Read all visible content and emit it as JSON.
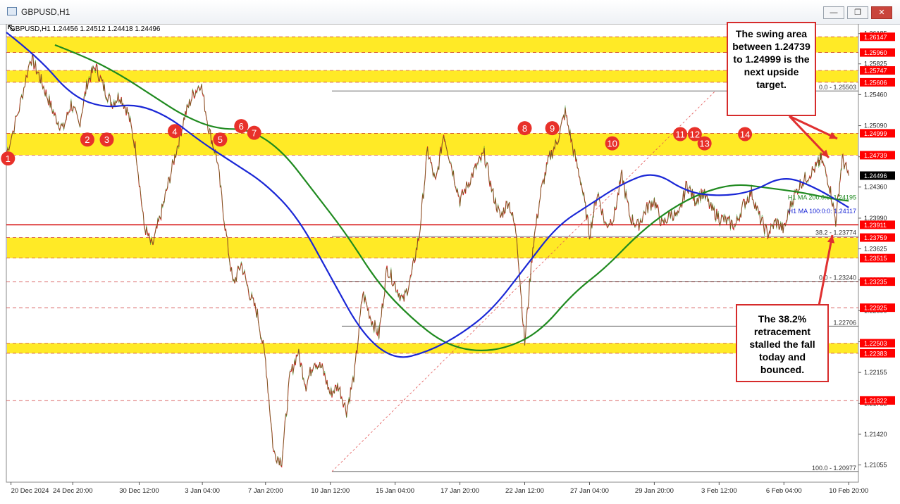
{
  "window": {
    "title": "GBPUSD,H1",
    "buttons": [
      "minimize-icon",
      "restore-icon",
      "close-icon"
    ]
  },
  "ohlc_header": "GBPUSD,H1  1.24456 1.24512 1.24418 1.24496",
  "colors": {
    "zone": "#ffe600",
    "ma100": "#1a27d6",
    "ma200": "#1f8a1f",
    "candle": "#cc2020",
    "callout_border": "#d62b2b",
    "marker": "#e8312a",
    "current_price_bg": "#000000"
  },
  "chart_data": {
    "type": "line",
    "title": "GBPUSD,H1",
    "ylim": [
      1.2085,
      1.263
    ],
    "y_ticks": [
      "1.26185",
      "1.25825",
      "1.25460",
      "1.25090",
      "1.24720",
      "1.24360",
      "1.23990",
      "1.23625",
      "1.23255",
      "1.22890",
      "1.22520",
      "1.22155",
      "1.21785",
      "1.21420",
      "1.21055"
    ],
    "x_ticks": [
      "20 Dec 2024",
      "24 Dec 20:00",
      "30 Dec 12:00",
      "3 Jan 04:00",
      "7 Jan 20:00",
      "10 Jan 12:00",
      "15 Jan 04:00",
      "17 Jan 20:00",
      "22 Jan 12:00",
      "27 Jan 04:00",
      "29 Jan 20:00",
      "3 Feb 12:00",
      "6 Feb 04:00",
      "10 Feb 20:00"
    ],
    "zones": [
      {
        "low": 1.2596,
        "high": 1.26147
      },
      {
        "low": 1.25606,
        "high": 1.25747
      },
      {
        "low": 1.24739,
        "high": 1.24999
      },
      {
        "low": 1.23515,
        "high": 1.23759
      },
      {
        "low": 1.22383,
        "high": 1.22503
      }
    ],
    "price_labels": [
      {
        "value": 1.26147,
        "text": "1.26147",
        "color": "#ff0000"
      },
      {
        "value": 1.2596,
        "text": "1.25960",
        "color": "#ff0000"
      },
      {
        "value": 1.25747,
        "text": "1.25747",
        "color": "#ff0000"
      },
      {
        "value": 1.25606,
        "text": "1.25606",
        "color": "#ff0000"
      },
      {
        "value": 1.24999,
        "text": "1.24999",
        "color": "#ff0000"
      },
      {
        "value": 1.24739,
        "text": "1.24739",
        "color": "#ff0000"
      },
      {
        "value": 1.24496,
        "text": "1.24496",
        "color": "#000000"
      },
      {
        "value": 1.23911,
        "text": "1.23911",
        "color": "#ff0000"
      },
      {
        "value": 1.23759,
        "text": "1.23759",
        "color": "#ff0000"
      },
      {
        "value": 1.23515,
        "text": "1.23515",
        "color": "#ff0000"
      },
      {
        "value": 1.23235,
        "text": "1.23235",
        "color": "#ff0000"
      },
      {
        "value": 1.22925,
        "text": "1.22925",
        "color": "#ff0000"
      },
      {
        "value": 1.22503,
        "text": "1.22503",
        "color": "#ff0000"
      },
      {
        "value": 1.22383,
        "text": "1.22383",
        "color": "#ff0000"
      },
      {
        "value": 1.21822,
        "text": "1.21822",
        "color": "#ff0000"
      }
    ],
    "fib_levels": [
      {
        "value": 1.25503,
        "text": "0.0 - 1.25503"
      },
      {
        "value": 1.23774,
        "text": "38.2 - 1.23774"
      },
      {
        "value": 1.2324,
        "text": "0.0 - 1.23240"
      },
      {
        "value": 1.22706,
        "text": "1.22706"
      },
      {
        "value": 1.20977,
        "text": "100.0 - 1.20977"
      }
    ],
    "ma_labels": [
      {
        "text": "H1 MA 200:0:0: 1.24195",
        "value": 1.24195,
        "color": "#1f8a1f"
      },
      {
        "text": "H1 MA 100:0:0: 1.24117",
        "value": 1.24117,
        "color": "#1a27d6"
      }
    ],
    "series": [
      {
        "name": "Price",
        "x": [
          0,
          0.8,
          1.5,
          2,
          2.5,
          3,
          3.5,
          4,
          4.5,
          5,
          5.5,
          6,
          6.5,
          7,
          7.5,
          8,
          8.5,
          9,
          9.5,
          10,
          10.5,
          11,
          11.5,
          12,
          12.5,
          13,
          13.5,
          14,
          14.5,
          15,
          15.5,
          16,
          16.5,
          17,
          17.5,
          18,
          18.5,
          19,
          19.5,
          20,
          20.5,
          21,
          21.5,
          22,
          22.5,
          23,
          23.5,
          24,
          24.5,
          25,
          25.5,
          26,
          26.5,
          27,
          27.5,
          28,
          28.5,
          29,
          29.5,
          30,
          30.5,
          31,
          31.5,
          32,
          32.5,
          33,
          33.5,
          34,
          34.5,
          35,
          35.5,
          36,
          36.5,
          37,
          37.5,
          38,
          38.5,
          39,
          39.5,
          40,
          40.5,
          41,
          41.5,
          42,
          42.5,
          43,
          43.5,
          44,
          44.5,
          45,
          45.5,
          46,
          46.5,
          47,
          47.5,
          48,
          48.5,
          49,
          49.5,
          50,
          50.3,
          50.8,
          51.2,
          51.6,
          52
        ],
        "y": [
          1.2475,
          1.253,
          1.259,
          1.257,
          1.2545,
          1.252,
          1.2505,
          1.2535,
          1.251,
          1.256,
          1.258,
          1.2555,
          1.2535,
          1.2545,
          1.2525,
          1.248,
          1.239,
          1.2365,
          1.24,
          1.244,
          1.248,
          1.252,
          1.2545,
          1.256,
          1.2505,
          1.247,
          1.239,
          1.232,
          1.2345,
          1.231,
          1.2285,
          1.223,
          1.212,
          1.211,
          1.221,
          1.224,
          1.22,
          1.223,
          1.222,
          1.219,
          1.22,
          1.217,
          1.2215,
          1.231,
          1.228,
          1.226,
          1.234,
          1.232,
          1.23,
          1.233,
          1.238,
          1.248,
          1.244,
          1.25,
          1.246,
          1.242,
          1.244,
          1.246,
          1.2475,
          1.243,
          1.24,
          1.242,
          1.238,
          1.225,
          1.2365,
          1.243,
          1.247,
          1.249,
          1.2525,
          1.248,
          1.244,
          1.238,
          1.243,
          1.239,
          1.24,
          1.245,
          1.24,
          1.239,
          1.241,
          1.242,
          1.239,
          1.2405,
          1.24,
          1.244,
          1.242,
          1.243,
          1.241,
          1.24,
          1.2395,
          1.239,
          1.2415,
          1.243,
          1.24,
          1.238,
          1.2395,
          1.2385,
          1.242,
          1.244,
          1.245,
          1.246,
          1.247,
          1.244,
          1.2395,
          1.247,
          1.24496
        ]
      },
      {
        "name": "H1 MA 100",
        "x": [
          0,
          2,
          4,
          6,
          8,
          10,
          12,
          14,
          16,
          18,
          20,
          22,
          24,
          26,
          28,
          30,
          32,
          34,
          36,
          38,
          40,
          42,
          44,
          46,
          48,
          50,
          52
        ],
        "y": [
          1.262,
          1.259,
          1.2545,
          1.253,
          1.2535,
          1.252,
          1.249,
          1.2465,
          1.244,
          1.24,
          1.233,
          1.226,
          1.223,
          1.224,
          1.226,
          1.229,
          1.234,
          1.239,
          1.2415,
          1.244,
          1.2455,
          1.243,
          1.2425,
          1.243,
          1.245,
          1.2435,
          1.24117
        ]
      },
      {
        "name": "H1 MA 200",
        "x": [
          3,
          5,
          7,
          9,
          11,
          13,
          15,
          17,
          19,
          21,
          23,
          25,
          27,
          29,
          31,
          33,
          35,
          37,
          39,
          41,
          43,
          45,
          47,
          49,
          51,
          52
        ],
        "y": [
          1.2605,
          1.259,
          1.257,
          1.2545,
          1.252,
          1.2505,
          1.2505,
          1.248,
          1.243,
          1.238,
          1.232,
          1.228,
          1.225,
          1.224,
          1.2245,
          1.2265,
          1.231,
          1.234,
          1.238,
          1.241,
          1.243,
          1.244,
          1.2435,
          1.243,
          1.2422,
          1.24195
        ]
      }
    ],
    "markers": [
      {
        "label": "1",
        "x": 0.1,
        "y": 1.247
      },
      {
        "label": "2",
        "x": 5.0,
        "y": 1.24925
      },
      {
        "label": "3",
        "x": 6.2,
        "y": 1.24925
      },
      {
        "label": "4",
        "x": 10.4,
        "y": 1.25025
      },
      {
        "label": "5",
        "x": 13.2,
        "y": 1.24925
      },
      {
        "label": "6",
        "x": 14.5,
        "y": 1.25085
      },
      {
        "label": "7",
        "x": 15.3,
        "y": 1.25005
      },
      {
        "label": "8",
        "x": 32.0,
        "y": 1.2506
      },
      {
        "label": "9",
        "x": 33.7,
        "y": 1.2506
      },
      {
        "label": "10",
        "x": 37.4,
        "y": 1.2488
      },
      {
        "label": "11",
        "x": 41.6,
        "y": 1.2499
      },
      {
        "label": "12",
        "x": 42.5,
        "y": 1.2499
      },
      {
        "label": "13",
        "x": 43.1,
        "y": 1.2488
      },
      {
        "label": "14",
        "x": 45.6,
        "y": 1.2499
      }
    ],
    "current_price": 1.24496
  },
  "annotations": {
    "top_callout": "The swing area between 1.24739 to 1.24999 is the next upside target.",
    "bottom_callout": "The 38.2% retracement stalled the fall today and bounced."
  }
}
